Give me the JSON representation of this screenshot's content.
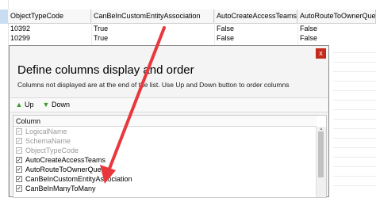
{
  "grid": {
    "columns": [
      "ObjectTypeCode",
      "CanBeInCustomEntityAssociation",
      "AutoCreateAccessTeams",
      "AutoRouteToOwnerQueue"
    ],
    "rows": [
      [
        "10392",
        "True",
        "False",
        "False"
      ],
      [
        "10299",
        "True",
        "False",
        "False"
      ]
    ]
  },
  "dialog": {
    "close_label": "x",
    "title": "Define columns display and order",
    "subtitle": "Columns not displayed are at the end of the list. Use Up and Down button to order columns",
    "toolbar": {
      "up_label": "Up",
      "down_label": "Down",
      "up_icon": "green-up-arrow-icon",
      "down_icon": "green-down-arrow-icon"
    },
    "list": {
      "header": "Column",
      "items": [
        {
          "label": "LogicalName",
          "checked": true,
          "disabled": true
        },
        {
          "label": "SchemaName",
          "checked": true,
          "disabled": true
        },
        {
          "label": "ObjectTypeCode",
          "checked": true,
          "disabled": true
        },
        {
          "label": "AutoCreateAccessTeams",
          "checked": true,
          "disabled": false
        },
        {
          "label": "AutoRouteToOwnerQueue",
          "checked": true,
          "disabled": false
        },
        {
          "label": "CanBeInCustomEntityAssociation",
          "checked": true,
          "disabled": false
        },
        {
          "label": "CanBeInManyToMany",
          "checked": true,
          "disabled": false
        }
      ]
    }
  },
  "annotation": {
    "arrow_color": "#e8383d"
  }
}
